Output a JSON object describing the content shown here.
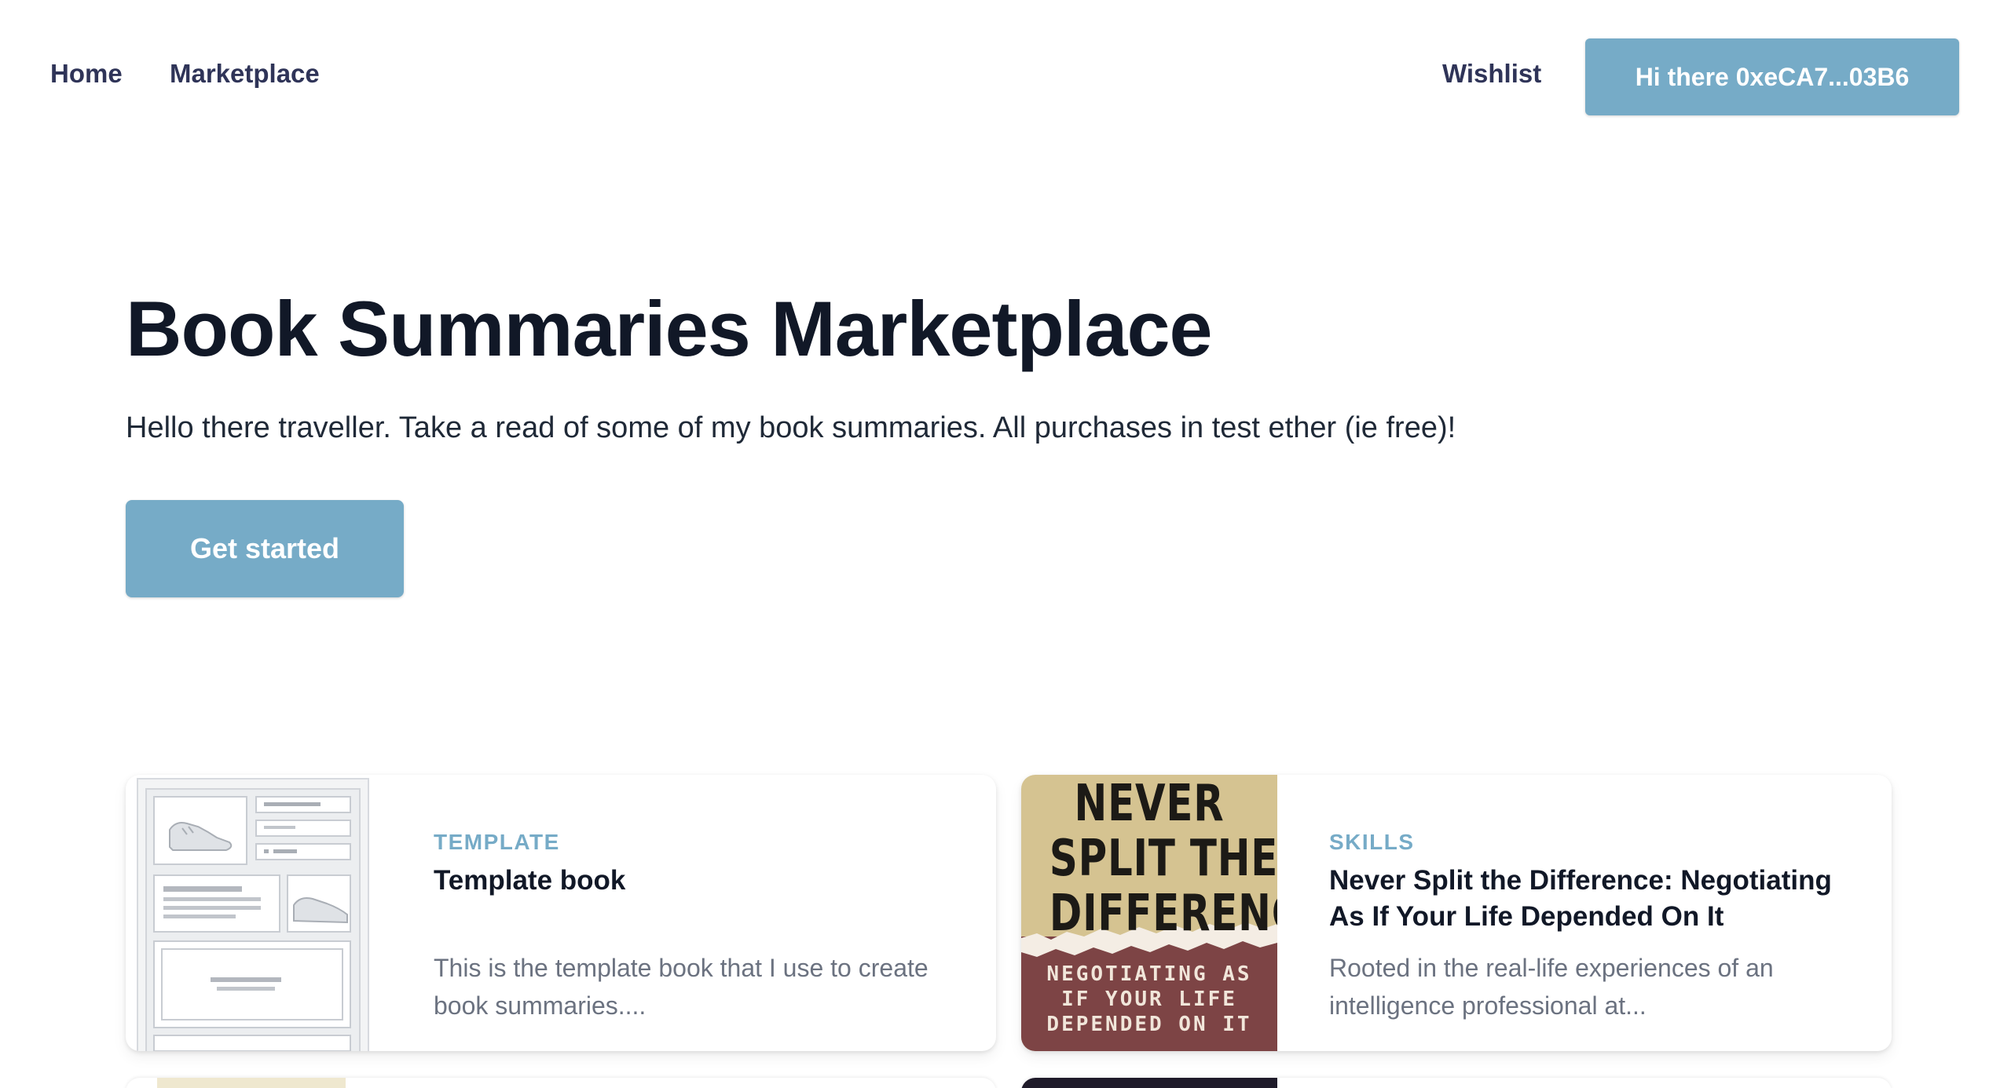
{
  "nav": {
    "home": "Home",
    "marketplace": "Marketplace",
    "wishlist": "Wishlist",
    "account_button": "Hi there 0xeCA7...03B6"
  },
  "hero": {
    "title": "Book Summaries Marketplace",
    "subtitle": "Hello there traveller. Take a read of some of my book summaries. All purchases in test ether (ie free)!",
    "cta": "Get started"
  },
  "cards": [
    {
      "category": "TEMPLATE",
      "title": "Template book",
      "description": "This is the template book that I use to create book summaries....",
      "image": "template-wireframe-thumbnail"
    },
    {
      "category": "SKILLS",
      "title": "Never Split the Difference: Negotiating As If Your Life Depended On It",
      "description": "Rooted in the real-life experiences of an intelligence professional at...",
      "image": "book-cover-never-split-the-difference",
      "cover": {
        "title_lines": [
          "NEVER",
          "SPLIT THE",
          "DIFFERENCE"
        ],
        "subtitle_lines": [
          "NEGOTIATING AS",
          "IF YOUR LIFE",
          "DEPENDED ON IT"
        ]
      }
    }
  ],
  "colors": {
    "accent": "#76abc7",
    "nav_text": "#2f3458",
    "heading": "#111827",
    "muted": "#6b7280",
    "cover_tan": "#d5c391",
    "cover_red": "#7d4445"
  }
}
